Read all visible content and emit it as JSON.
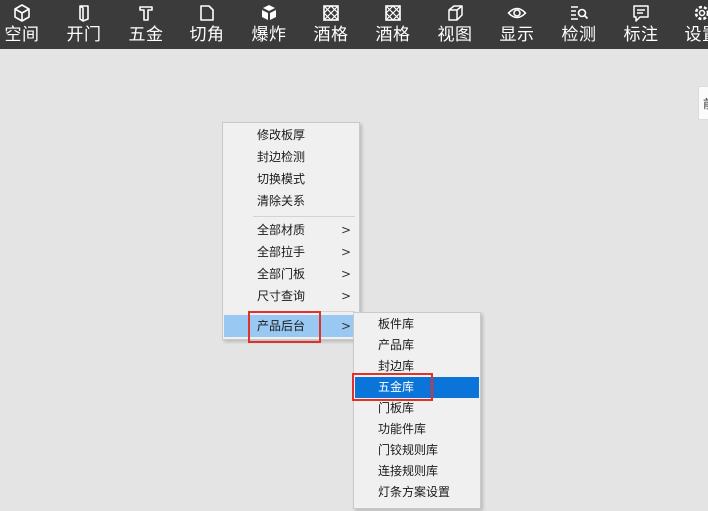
{
  "toolbar": {
    "items": [
      {
        "label": "空间",
        "icon": "cube-outline-icon"
      },
      {
        "label": "开门",
        "icon": "door-icon"
      },
      {
        "label": "五金",
        "icon": "hammer-icon"
      },
      {
        "label": "切角",
        "icon": "corner-cut-icon"
      },
      {
        "label": "爆炸",
        "icon": "explode-cube-icon"
      },
      {
        "label": "酒格",
        "icon": "wine-rack-icon"
      },
      {
        "label": "酒格",
        "icon": "wine-rack-icon"
      },
      {
        "label": "视图",
        "icon": "view-cube-icon"
      },
      {
        "label": "显示",
        "icon": "eye-icon"
      },
      {
        "label": "检测",
        "icon": "inspect-list-icon"
      },
      {
        "label": "标注",
        "icon": "comment-icon"
      },
      {
        "label": "设置",
        "icon": "gear-icon"
      }
    ]
  },
  "side_tab": {
    "label": "前"
  },
  "context_menu": {
    "items": [
      {
        "label": "修改板厚"
      },
      {
        "label": "封边检测"
      },
      {
        "label": "切换模式"
      },
      {
        "label": "清除关系"
      },
      {
        "label": "全部材质",
        "arrow": ">"
      },
      {
        "label": "全部拉手",
        "arrow": ">"
      },
      {
        "label": "全部门板",
        "arrow": ">"
      },
      {
        "label": "尺寸查询",
        "arrow": ">"
      },
      {
        "label": "产品后台",
        "arrow": ">",
        "highlighted": true
      }
    ]
  },
  "submenu": {
    "items": [
      {
        "label": "板件库"
      },
      {
        "label": "产品库"
      },
      {
        "label": "封边库"
      },
      {
        "label": "五金库",
        "selected": true
      },
      {
        "label": "门板库"
      },
      {
        "label": "功能件库"
      },
      {
        "label": "门铰规则库"
      },
      {
        "label": "连接规则库"
      },
      {
        "label": "灯条方案设置"
      }
    ]
  },
  "colors": {
    "toolbar_bg": "#3b3b3b",
    "canvas_bg": "#e4e4e4",
    "hover_light": "#99c9f3",
    "selected": "#0a74d8",
    "annotation": "#e0312b"
  }
}
